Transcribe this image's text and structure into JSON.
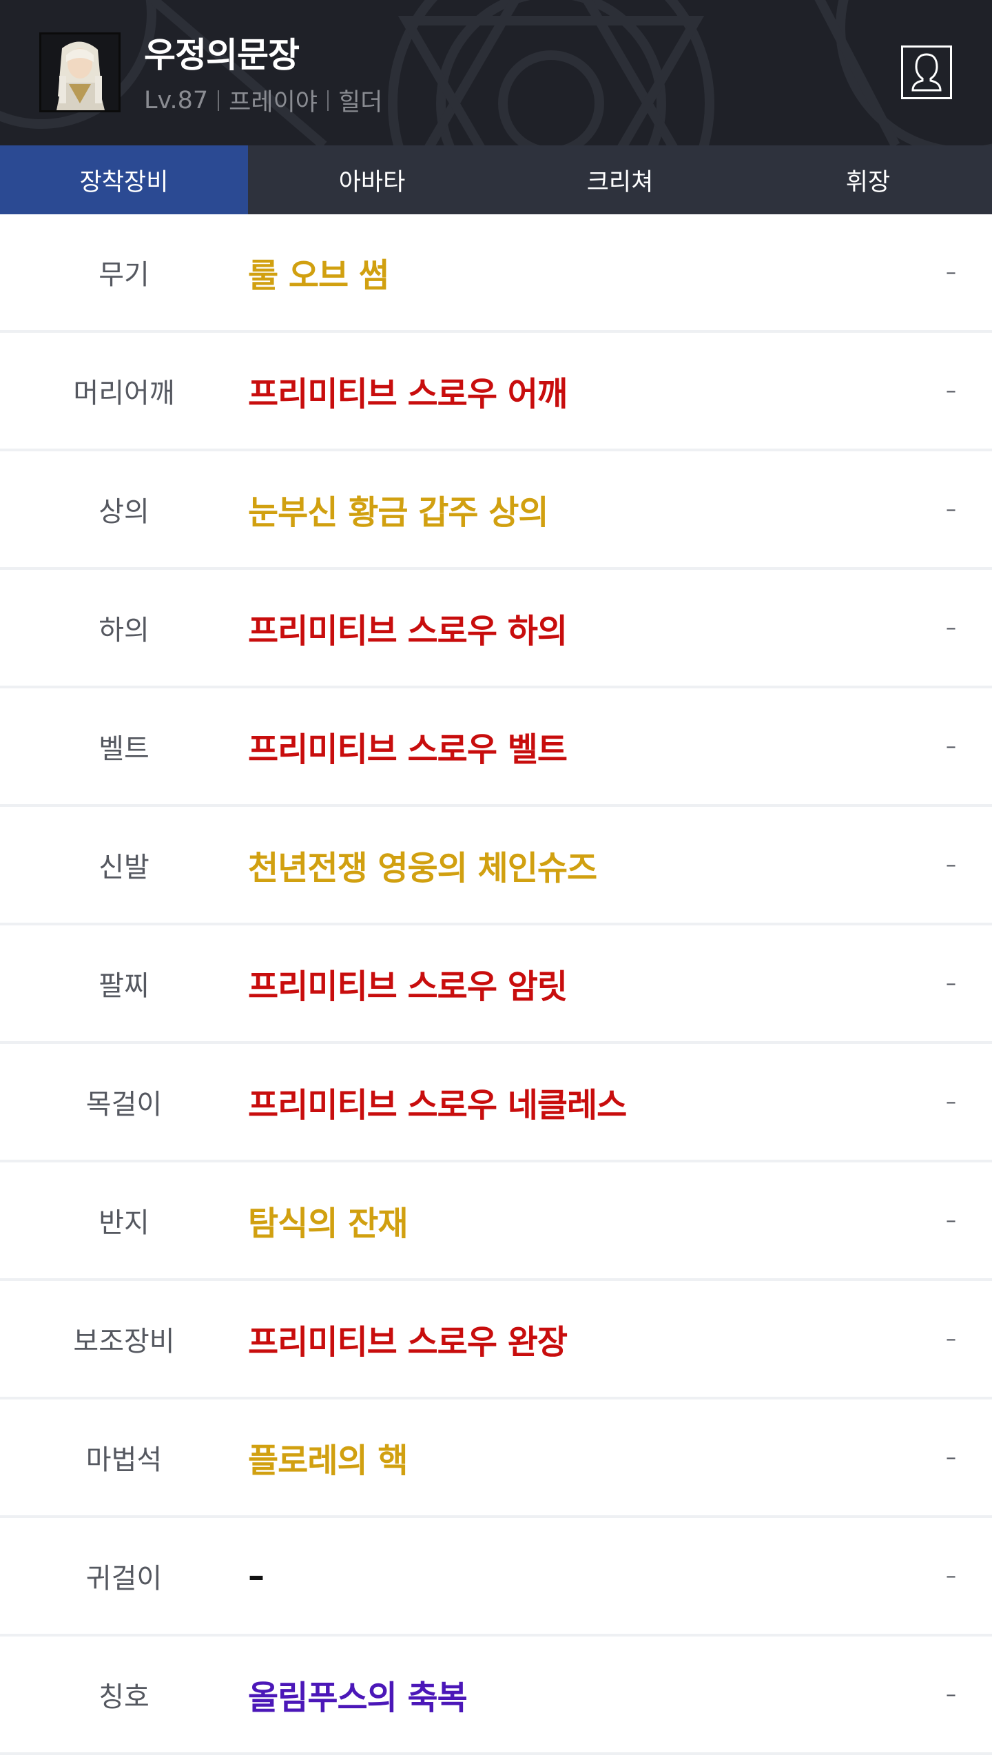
{
  "header": {
    "name": "우정의문장",
    "level": "Lv.87",
    "server": "프레이야",
    "job": "힐더",
    "avatar_icon": "character-portrait",
    "profile_icon": "user-profile-icon"
  },
  "tabs": [
    {
      "label": "장착장비",
      "active": true
    },
    {
      "label": "아바타",
      "active": false
    },
    {
      "label": "크리쳐",
      "active": false
    },
    {
      "label": "휘장",
      "active": false
    }
  ],
  "colors": {
    "gold": "#d1a010",
    "red": "#c80d0d",
    "purple": "#4b17b8",
    "active_tab": "#2b4a93",
    "tab_bar": "#2e323d",
    "header_bg": "#1f2128"
  },
  "equipment": [
    {
      "slot": "무기",
      "item": "룰 오브 썸",
      "color": "gold",
      "extra": "–"
    },
    {
      "slot": "머리어깨",
      "item": "프리미티브 스로우 어깨",
      "color": "red",
      "extra": "–"
    },
    {
      "slot": "상의",
      "item": "눈부신 황금 갑주 상의",
      "color": "gold",
      "extra": "–"
    },
    {
      "slot": "하의",
      "item": "프리미티브 스로우 하의",
      "color": "red",
      "extra": "–"
    },
    {
      "slot": "벨트",
      "item": "프리미티브 스로우 벨트",
      "color": "red",
      "extra": "–"
    },
    {
      "slot": "신발",
      "item": "천년전쟁 영웅의 체인슈즈",
      "color": "gold",
      "extra": "–"
    },
    {
      "slot": "팔찌",
      "item": "프리미티브 스로우 암릿",
      "color": "red",
      "extra": "–"
    },
    {
      "slot": "목걸이",
      "item": "프리미티브 스로우 네클레스",
      "color": "red",
      "extra": "–"
    },
    {
      "slot": "반지",
      "item": "탐식의 잔재",
      "color": "gold",
      "extra": "–"
    },
    {
      "slot": "보조장비",
      "item": "프리미티브 스로우 완장",
      "color": "red",
      "extra": "–"
    },
    {
      "slot": "마법석",
      "item": "플로레의 핵",
      "color": "gold",
      "extra": "–"
    },
    {
      "slot": "귀걸이",
      "item": "–",
      "color": "black",
      "extra": "–"
    },
    {
      "slot": "칭호",
      "item": "올림푸스의 축복",
      "color": "purple",
      "extra": "–"
    }
  ]
}
